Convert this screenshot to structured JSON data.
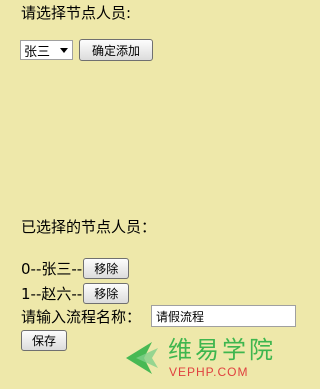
{
  "page": {
    "select_label": "请选择节点人员:",
    "selected_value": "张三",
    "confirm_button": "确定添加",
    "selected_list_label": "已选择的节点人员：",
    "selected_items": [
      {
        "text": "0--张三--",
        "remove_label": "移除"
      },
      {
        "text": "1--赵六--",
        "remove_label": "移除"
      }
    ],
    "flow_name_label": "请输入流程名称：",
    "flow_name_value": "请假流程",
    "save_button": "保存"
  },
  "watermark": {
    "text_cn": "维易学院",
    "text_en": "VEPHP.COM",
    "color_green": "#35b44a",
    "color_red": "#e0413f"
  },
  "colors": {
    "background": "#EEE8AA"
  }
}
